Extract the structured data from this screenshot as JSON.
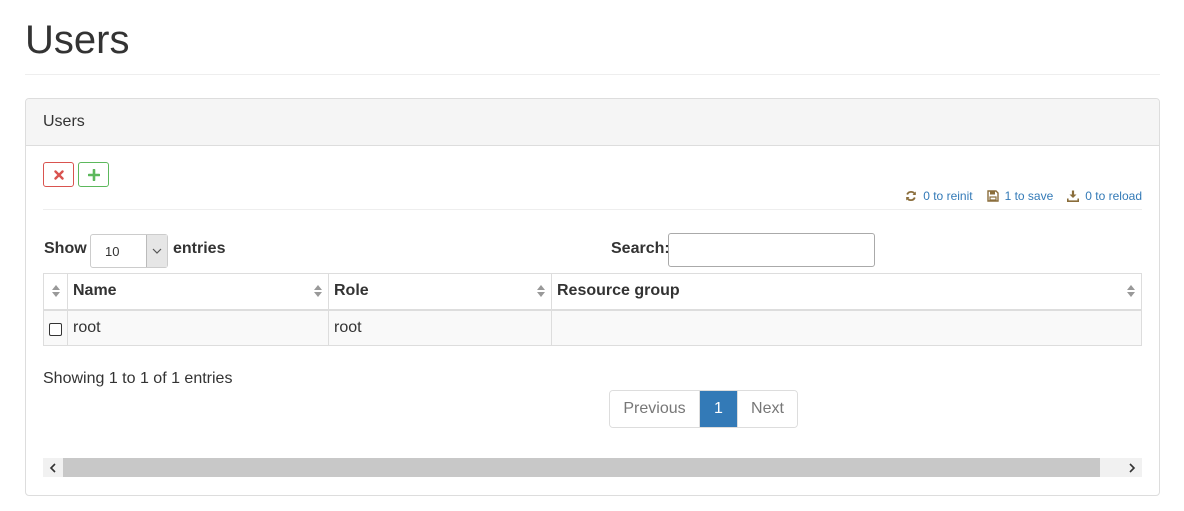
{
  "page": {
    "title": "Users"
  },
  "panel": {
    "heading": "Users"
  },
  "toolbar": {
    "delete_icon": "times-icon",
    "add_icon": "plus-icon"
  },
  "status": {
    "reinit_label": "0 to reinit",
    "save_label": "1 to save",
    "reload_label": "0 to reload"
  },
  "table_controls": {
    "show_label": "Show",
    "entries_label": "entries",
    "page_length": "10",
    "search_label": "Search:",
    "search_value": ""
  },
  "table": {
    "columns": [
      "Name",
      "Role",
      "Resource group"
    ],
    "rows": [
      {
        "name": "root",
        "role": "root",
        "resource_group": ""
      }
    ]
  },
  "footer": {
    "info": "Showing 1 to 1 of 1 entries",
    "previous_label": "Previous",
    "current_page": "1",
    "next_label": "Next"
  },
  "colors": {
    "primary": "#337ab7",
    "danger": "#d9534f",
    "success": "#5cb85c",
    "status_icon": "#8a6d3b"
  }
}
